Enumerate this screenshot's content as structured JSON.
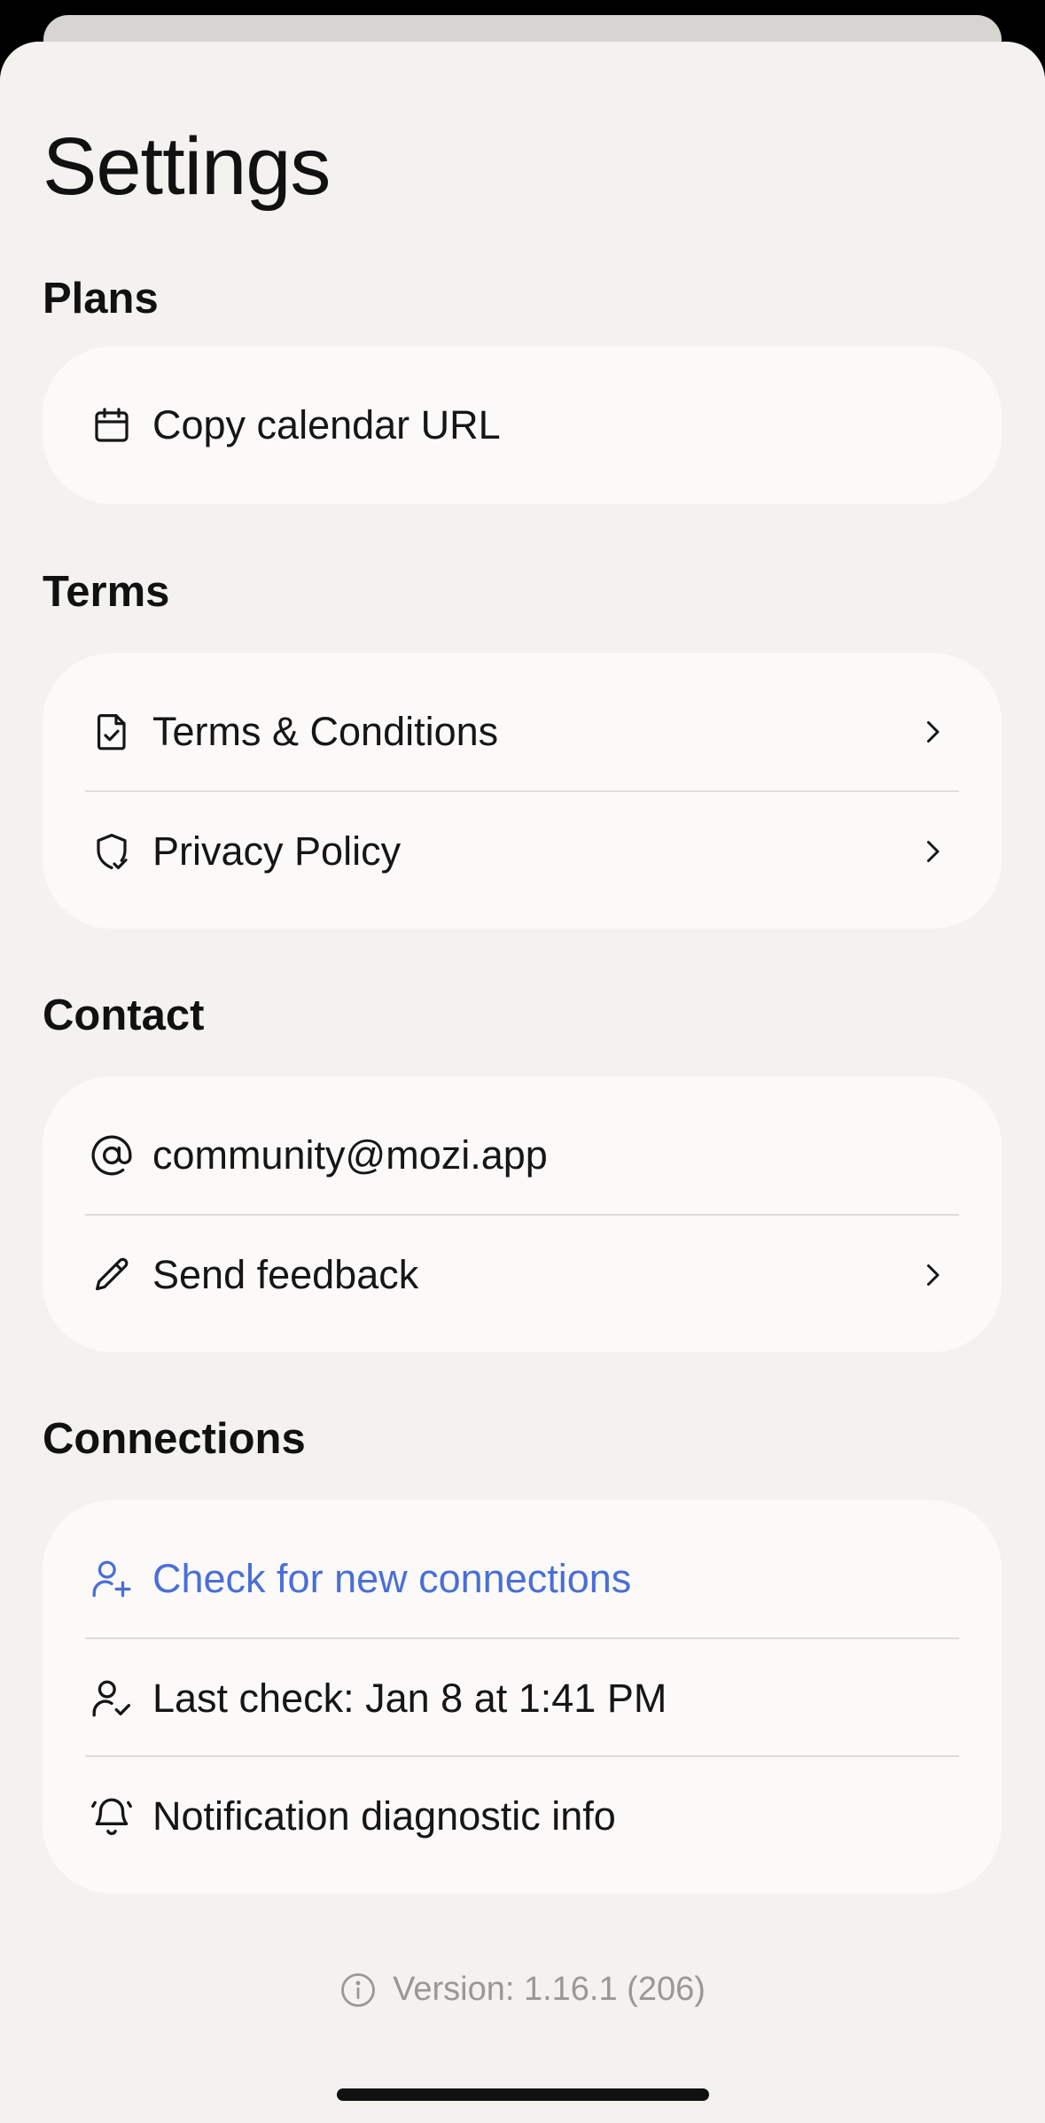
{
  "header": {
    "title": "Settings"
  },
  "sections": {
    "plans": {
      "heading": "Plans",
      "items": [
        {
          "label": "Copy calendar URL",
          "icon": "calendar-icon"
        }
      ]
    },
    "terms": {
      "heading": "Terms",
      "items": [
        {
          "label": "Terms & Conditions",
          "icon": "document-check-icon",
          "chevron": true
        },
        {
          "label": "Privacy Policy",
          "icon": "shield-check-icon",
          "chevron": true
        }
      ]
    },
    "contact": {
      "heading": "Contact",
      "items": [
        {
          "label": "community@mozi.app",
          "icon": "at-sign-icon"
        },
        {
          "label": "Send feedback",
          "icon": "pencil-icon",
          "chevron": true
        }
      ]
    },
    "connections": {
      "heading": "Connections",
      "items": [
        {
          "label": "Check for new connections",
          "icon": "user-plus-icon",
          "accent": "#4a6fd6"
        },
        {
          "label": "Last check: Jan 8 at 1:41 PM",
          "icon": "user-check-icon"
        },
        {
          "label": "Notification diagnostic info",
          "icon": "bell-icon"
        }
      ]
    }
  },
  "footer": {
    "version_text": "Version: 1.16.1 (206)",
    "icon": "info-icon"
  },
  "colors": {
    "sheet_background": "#f4f2ef",
    "card_background": "#fbfaf9",
    "accent_link": "#4a6fd6",
    "muted_text": "#9a9896"
  }
}
